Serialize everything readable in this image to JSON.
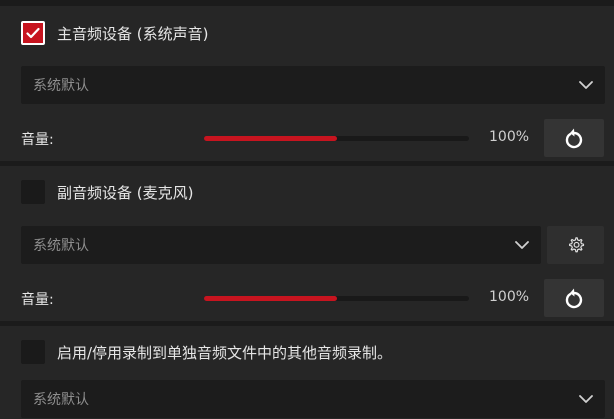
{
  "section1": {
    "checkbox_label": "主音频设备 (系统声音)",
    "checked": true,
    "device_select": "系统默认",
    "volume_label": "音量:",
    "volume_value": "100%",
    "volume_fraction": 0.5
  },
  "section2": {
    "checkbox_label": "副音频设备 (麦克风)",
    "checked": false,
    "device_select": "系统默认",
    "volume_label": "音量:",
    "volume_value": "100%",
    "volume_fraction": 0.5
  },
  "section3": {
    "checkbox_label": "启用/停用录制到单独音频文件中的其他音频录制。",
    "checked": false,
    "device_select": "系统默认"
  },
  "colors": {
    "accent": "#c7141f",
    "background": "#262626",
    "control": "#1c1c1c"
  },
  "icons": {
    "check": "checkmark-icon",
    "dropdown": "chevron-down-icon",
    "settings": "gear-icon",
    "reset": "reset-icon"
  }
}
